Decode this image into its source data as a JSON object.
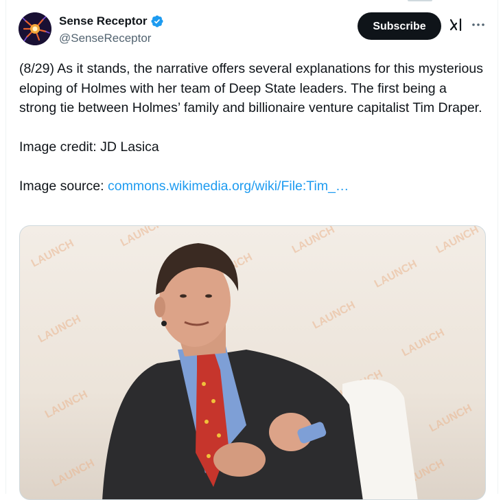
{
  "author": {
    "display_name": "Sense Receptor",
    "handle": "@SenseReceptor",
    "verified": true,
    "avatar_icon": "neuron-avatar-icon"
  },
  "header_actions": {
    "subscribe_label": "Subscribe",
    "grok_icon": "grok-icon",
    "more_icon": "more-options-icon"
  },
  "tweet": {
    "paragraph_1": "(8/29) As it stands, the narrative offers several explanations for this mysterious eloping of Holmes with her team of Deep State leaders. The first being a strong tie between Holmes’ family and billionaire venture capitalist Tim Draper.",
    "paragraph_2": "Image credit: JD Lasica",
    "source_prefix": "Image source: ",
    "source_link": "commons.wikimedia.org/wiki/File:Tim_…"
  },
  "media": {
    "backdrop_text": "LAUNCH"
  },
  "colors": {
    "link": "#1d9bf0",
    "subscribe_bg": "#0f1419",
    "verified": "#1d9bf0",
    "secondary_text": "#536471"
  }
}
